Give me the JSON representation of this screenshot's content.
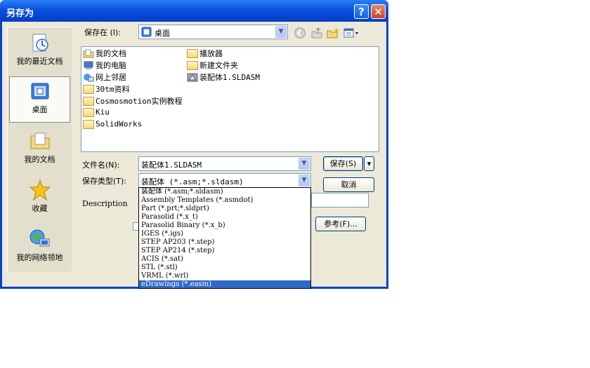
{
  "window": {
    "title": "另存为",
    "help_label": "?",
    "close_label": "✕"
  },
  "places": [
    {
      "label": "我的最近文档",
      "icon": "recent-documents-icon"
    },
    {
      "label": "桌面",
      "icon": "desktop-icon"
    },
    {
      "label": "我的文档",
      "icon": "my-documents-icon"
    },
    {
      "label": "收藏",
      "icon": "favorites-icon"
    },
    {
      "label": "我的网络领地",
      "icon": "network-places-icon"
    }
  ],
  "savein": {
    "label": "保存在 (I):",
    "value": "桌面"
  },
  "files": [
    {
      "name": "我的文档",
      "icon": "my-documents-icon"
    },
    {
      "name": "我的电脑",
      "icon": "my-computer-icon"
    },
    {
      "name": "网上邻居",
      "icon": "network-icon"
    },
    {
      "name": "30tm资料",
      "icon": "folder-icon"
    },
    {
      "name": "Cosmosmotion实例教程",
      "icon": "folder-icon"
    },
    {
      "name": "Kiu",
      "icon": "folder-icon"
    },
    {
      "name": "SolidWorks",
      "icon": "folder-icon"
    },
    {
      "name": "播放器",
      "icon": "folder-icon"
    },
    {
      "name": "新建文件夹",
      "icon": "folder-icon"
    },
    {
      "name": "装配体1.SLDASM",
      "icon": "assembly-file-icon"
    }
  ],
  "filename": {
    "label": "文件名(N):",
    "value": "装配体1.SLDASM"
  },
  "savetype": {
    "label": "保存类型(T):",
    "value": "装配体 (*.asm;*.sldasm)"
  },
  "description_label": "Description",
  "buttons": {
    "save": "保存(S)",
    "save_menu": "▾",
    "cancel": "取消",
    "browse": "参考(F)..."
  },
  "type_options": [
    "装配体 (*.asm;*.sldasm)",
    "Assembly Templates (*.asmdot)",
    "Part (*.prt;*.sldprt)",
    "Parasolid (*.x_t)",
    "Parasolid Binary (*.x_b)",
    "IGES (*.igs)",
    "STEP AP203 (*.step)",
    "STEP AP214 (*.step)",
    "ACIS (*.sat)",
    "STL (*.stl)",
    "VRML (*.wrl)",
    "eDrawings (*.easm)"
  ],
  "type_options_highlighted": "eDrawings (*.easm)",
  "colors": {
    "title_bar": "#0a56e0",
    "dialog_bg": "#ece9d8",
    "highlight": "#316ac5"
  }
}
